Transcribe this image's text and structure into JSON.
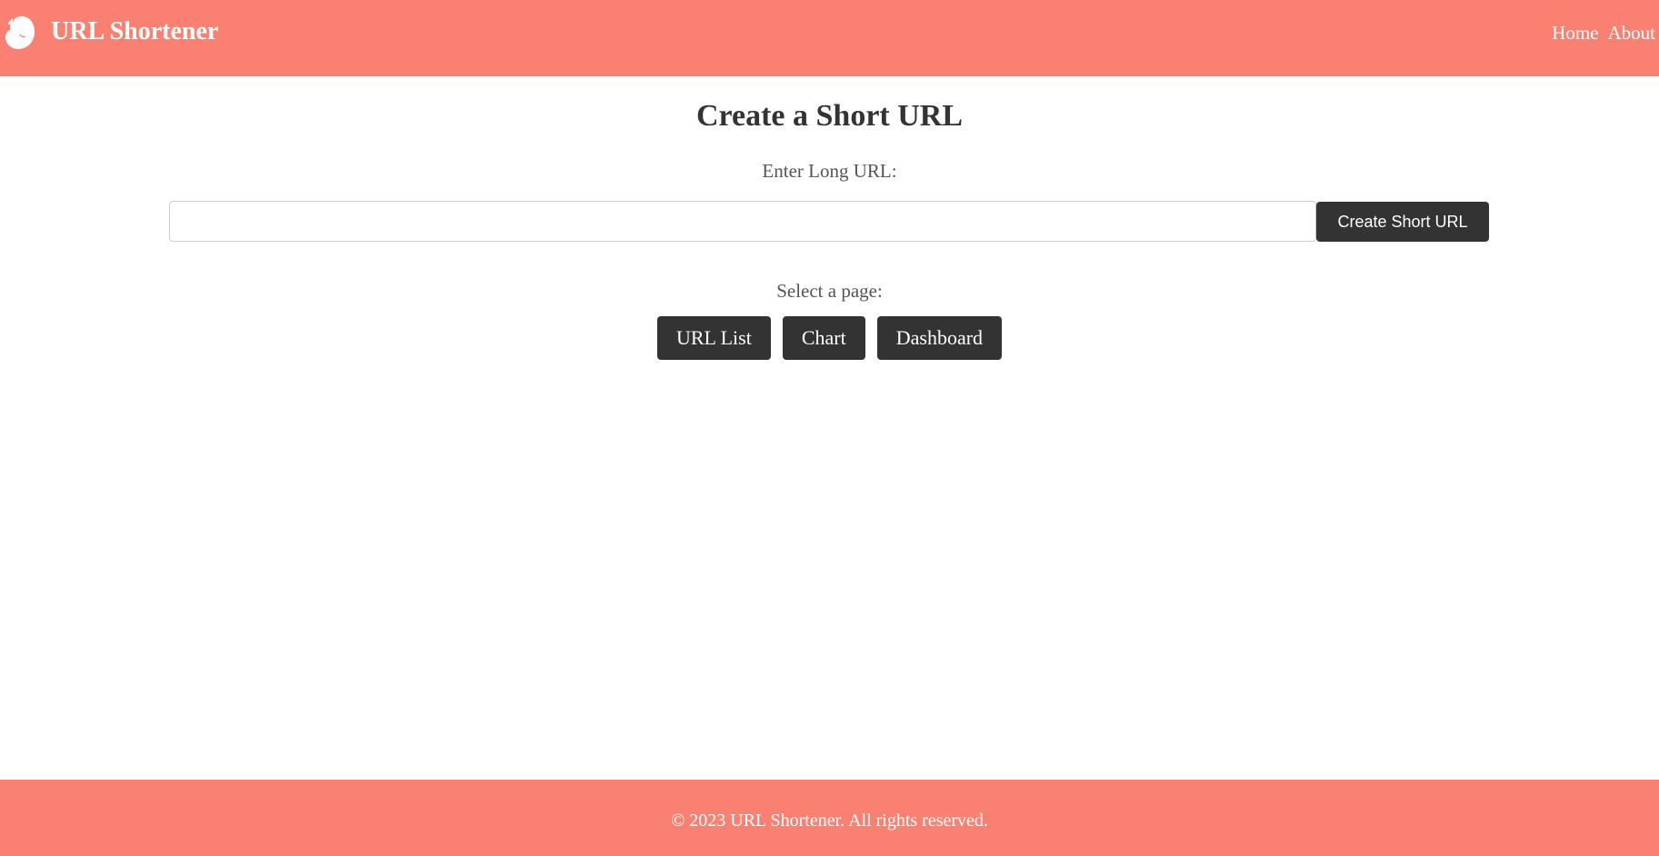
{
  "header": {
    "logo_icon": "evernote-elephant-icon",
    "title": "URL Shortener",
    "nav": {
      "home": "Home",
      "about": "About"
    }
  },
  "main": {
    "title": "Create a Short URL",
    "url_label": "Enter Long URL:",
    "url_input": {
      "value": "",
      "placeholder": ""
    },
    "create_button": "Create Short URL",
    "select_label": "Select a page:",
    "page_buttons": {
      "url_list": "URL List",
      "chart": "Chart",
      "dashboard": "Dashboard"
    }
  },
  "footer": {
    "text": "© 2023 URL Shortener. All rights reserved."
  },
  "colors": {
    "brand": "#fa8072",
    "button": "#333333",
    "text": "#333333"
  }
}
